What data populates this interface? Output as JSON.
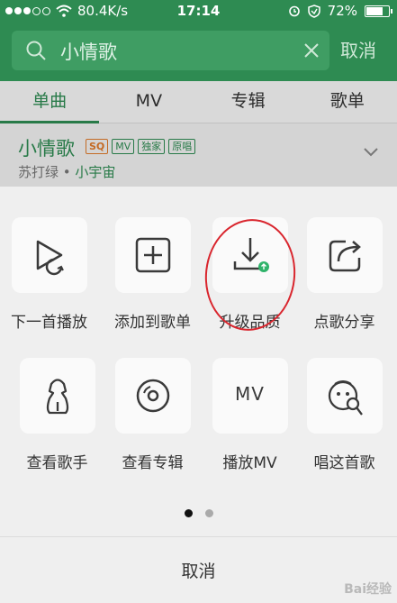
{
  "status_bar": {
    "network_speed": "80.4K/s",
    "time": "17:14",
    "battery": "72%"
  },
  "search": {
    "query": "小情歌",
    "cancel_label": "取消"
  },
  "tabs": [
    {
      "label": "单曲"
    },
    {
      "label": "MV"
    },
    {
      "label": "专辑"
    },
    {
      "label": "歌单"
    }
  ],
  "song": {
    "title": "小情歌",
    "badges": [
      "SQ",
      "MV",
      "独家",
      "原唱"
    ],
    "artist": "苏打绿",
    "album": "小宇宙"
  },
  "actions": [
    {
      "label": "下一首播放",
      "icon": "play-next-icon"
    },
    {
      "label": "添加到歌单",
      "icon": "add-to-playlist-icon"
    },
    {
      "label": "升级品质",
      "icon": "download-upgrade-icon"
    },
    {
      "label": "点歌分享",
      "icon": "share-icon"
    },
    {
      "label": "查看歌手",
      "icon": "singer-icon"
    },
    {
      "label": "查看专辑",
      "icon": "album-disc-icon"
    },
    {
      "label": "播放MV",
      "icon": "mv-icon",
      "icon_text": "MV"
    },
    {
      "label": "唱这首歌",
      "icon": "karaoke-icon"
    }
  ],
  "pager": {
    "pages": 2,
    "current": 1
  },
  "sheet_cancel_label": "取消",
  "watermark": "Bai经验",
  "colors": {
    "brand": "#2e8b52",
    "badge_sq": "#e07a2b",
    "annotation": "#d9262e",
    "upgrade_dot": "#2fb36a"
  }
}
